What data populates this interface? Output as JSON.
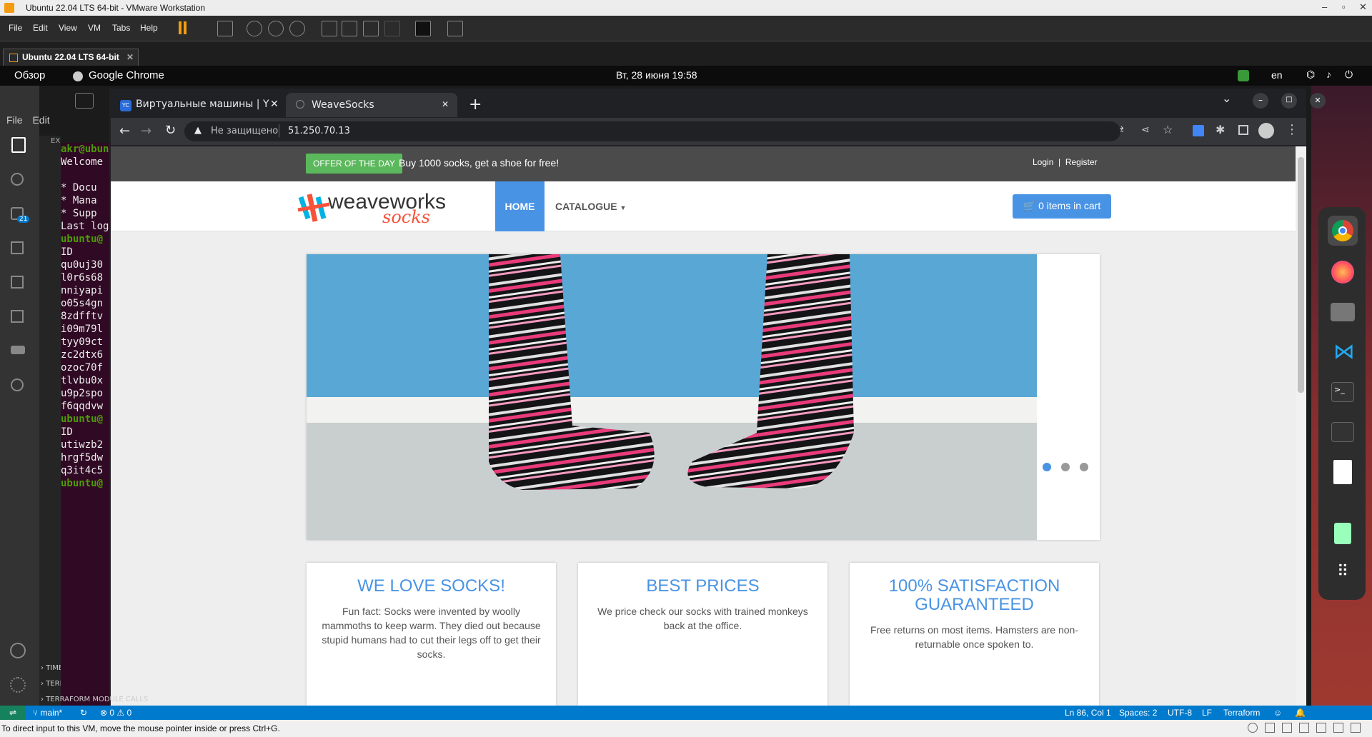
{
  "vmware": {
    "title": "Ubuntu 22.04 LTS 64-bit - VMware Workstation",
    "menu": [
      "File",
      "Edit",
      "View",
      "VM",
      "Tabs",
      "Help"
    ],
    "tab": "Ubuntu 22.04 LTS 64-bit",
    "status": "To direct input to this VM, move the mouse pointer inside or press Ctrl+G."
  },
  "ubuntu": {
    "activities": "Обзор",
    "app": "Google Chrome",
    "clock": "Вт, 28 июня  19:58",
    "lang": "en"
  },
  "vscode": {
    "menu": [
      "File",
      "Edit"
    ],
    "explorer_label": "EX",
    "scm_badge": "21",
    "sections": [
      "TIMELINE",
      "TERRAFORM PI",
      "TERRAFORM MODULE CALLS"
    ],
    "terminal": [
      "akr@ubun",
      "Welcome",
      "",
      "* Docu",
      "* Mana",
      "* Supp",
      "Last log",
      "ubuntu@",
      "ID",
      "qu0uj30",
      "l0r6s68",
      "nniyapi",
      "o05s4gn",
      "8zdfftv",
      "i09m79l",
      "tyy09ct",
      "zc2dtx6",
      "ozoc70f",
      "tlvbu0x",
      "u9p2spo",
      "f6qqdvw",
      "ubuntu@",
      "ID",
      "utiwzb2",
      "hrgf5dw",
      "q3it4c5",
      "ubuntu@"
    ],
    "status": {
      "branch": "main*",
      "errors": "0",
      "warnings": "0",
      "position": "Ln 86, Col 1",
      "spaces": "Spaces: 2",
      "encoding": "UTF-8",
      "eol": "LF",
      "language": "Terraform"
    }
  },
  "chrome": {
    "tab1": "Виртуальные машины | Y",
    "tab2": "WeaveSocks",
    "not_secure": "Не защищено",
    "url": "51.250.70.13"
  },
  "site": {
    "offer_badge": "OFFER OF THE DAY",
    "offer_text": "Buy 1000 socks, get a shoe for free!",
    "login": "Login",
    "register": "Register",
    "logo_main": "weaveworks",
    "logo_sub": "socks",
    "nav_home": "HOME",
    "nav_catalogue": "CATALOGUE",
    "cart": "0 items in cart",
    "cards": [
      {
        "title": "WE LOVE SOCKS!",
        "text": "Fun fact: Socks were invented by woolly mammoths to keep warm. They died out because stupid humans had to cut their legs off to get their socks."
      },
      {
        "title": "BEST PRICES",
        "text": "We price check our socks with trained monkeys back at the office."
      },
      {
        "title": "100% SATISFACTION GUARANTEED",
        "text": "Free returns on most items. Hamsters are non-returnable once spoken to."
      }
    ]
  },
  "colors": {
    "accent": "#4993e4",
    "offer": "#5cb85c",
    "vscode_blue": "#007acc",
    "terminal_bg": "#300a24"
  }
}
